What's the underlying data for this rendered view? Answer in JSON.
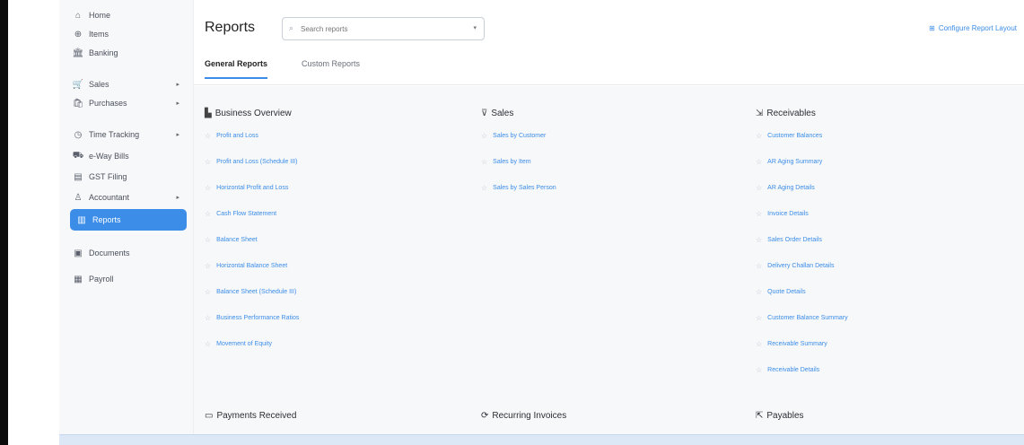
{
  "sidebar": {
    "items": [
      {
        "label": "Home",
        "icon": "home-icon",
        "glyph": "⌂"
      },
      {
        "label": "Items",
        "icon": "items-icon",
        "glyph": "⊕"
      },
      {
        "label": "Banking",
        "icon": "bank-icon",
        "glyph": "🏛"
      },
      {
        "label": "Sales",
        "icon": "cart-icon",
        "glyph": "🛒",
        "caret": "▸"
      },
      {
        "label": "Purchases",
        "icon": "bag-icon",
        "glyph": "🛍",
        "caret": "▸"
      },
      {
        "label": "Time Tracking",
        "icon": "clock-icon",
        "glyph": "◷",
        "caret": "▸"
      },
      {
        "label": "e-Way Bills",
        "icon": "truck-icon",
        "glyph": "⛟"
      },
      {
        "label": "GST Filing",
        "icon": "filing-icon",
        "glyph": "▤"
      },
      {
        "label": "Accountant",
        "icon": "user-icon",
        "glyph": "♙",
        "caret": "▸"
      },
      {
        "label": "Reports",
        "icon": "chart-icon",
        "glyph": "▥"
      },
      {
        "label": "Documents",
        "icon": "folder-icon",
        "glyph": "▣"
      },
      {
        "label": "Payroll",
        "icon": "payroll-icon",
        "glyph": "▦"
      }
    ]
  },
  "header": {
    "title": "Reports",
    "search_placeholder": "Search reports",
    "search_icon": "search-icon",
    "configure_label": "Configure Report Layout",
    "configure_icon": "grid-icon"
  },
  "tabs": [
    {
      "label": "General Reports",
      "active": true
    },
    {
      "label": "Custom Reports",
      "active": false
    }
  ],
  "sections": {
    "business_overview": {
      "title": "Business Overview",
      "icon": "bar-chart-icon",
      "items": [
        "Profit and Loss",
        "Profit and Loss (Schedule III)",
        "Horizontal Profit and Loss",
        "Cash Flow Statement",
        "Balance Sheet",
        "Horizontal Balance Sheet",
        "Balance Sheet (Schedule III)",
        "Business Performance Ratios",
        "Movement of Equity"
      ]
    },
    "sales": {
      "title": "Sales",
      "icon": "cart-icon",
      "items": [
        "Sales by Customer",
        "Sales by Item",
        "Sales by Sales Person"
      ]
    },
    "receivables": {
      "title": "Receivables",
      "icon": "receivables-icon",
      "items": [
        "Customer Balances",
        "AR Aging Summary",
        "AR Aging Details",
        "Invoice Details",
        "Sales Order Details",
        "Delivery Challan Details",
        "Quote Details",
        "Customer Balance Summary",
        "Receivable Summary",
        "Receivable Details"
      ]
    },
    "payments_received": {
      "title": "Payments Received",
      "icon": "payment-icon"
    },
    "recurring_invoices": {
      "title": "Recurring Invoices",
      "icon": "recurring-icon"
    },
    "payables": {
      "title": "Payables",
      "icon": "payables-icon"
    }
  },
  "colors": {
    "accent": "#3b8de8",
    "sidebar_bg": "#f7f8fa",
    "content_bg": "#f7f8fa"
  }
}
